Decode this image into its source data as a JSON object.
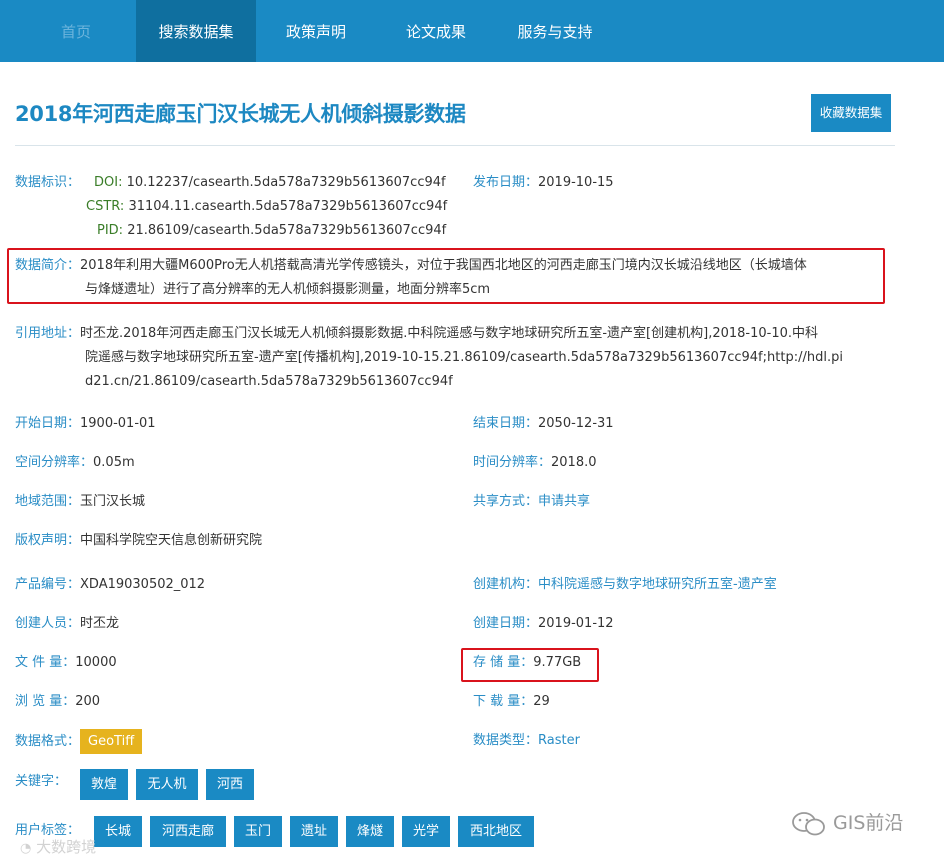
{
  "nav": {
    "home": "首页",
    "search": "搜索数据集",
    "policy": "政策声明",
    "papers": "论文成果",
    "service": "服务与支持"
  },
  "title": "2018年河西走廊玉门汉长城无人机倾斜摄影数据",
  "favorite_button": "收藏数据集",
  "identifiers": {
    "label": "数据标识：",
    "doi_key": "DOI:",
    "doi": "10.12237/casearth.5da578a7329b5613607cc94f",
    "cstr_key": "CSTR:",
    "cstr": "31104.11.casearth.5da578a7329b5613607cc94f",
    "pid_key": "PID:",
    "pid": "21.86109/casearth.5da578a7329b5613607cc94f"
  },
  "publish_date": {
    "label": "发布日期：",
    "value": "2019-10-15"
  },
  "summary": {
    "label": "数据简介：",
    "line1": "2018年利用大疆M600Pro无人机搭载高清光学传感镜头，对位于我国西北地区的河西走廊玉门境内汉长城沿线地区（长城墙体",
    "line2": "与烽燧遗址）进行了高分辨率的无人机倾斜摄影测量，地面分辨率5cm"
  },
  "citation": {
    "label": "引用地址：",
    "line1": "时丕龙.2018年河西走廊玉门汉长城无人机倾斜摄影数据.中科院遥感与数字地球研究所五室-遗产室[创建机构],2018-10-10.中科",
    "line2": "院遥感与数字地球研究所五室-遗产室[传播机构],2019-10-15.21.86109/casearth.5da578a7329b5613607cc94f;http://hdl.pi",
    "line3": "d21.cn/21.86109/casearth.5da578a7329b5613607cc94f"
  },
  "fields": {
    "start_date": {
      "label": "开始日期：",
      "value": "1900-01-01"
    },
    "end_date": {
      "label": "结束日期：",
      "value": "2050-12-31"
    },
    "spatial_res": {
      "label": "空间分辨率：",
      "value": "0.05m"
    },
    "temporal_res": {
      "label": "时间分辨率：",
      "value": "2018.0"
    },
    "region": {
      "label": "地域范围：",
      "value": "玉门汉长城"
    },
    "share_mode": {
      "label": "共享方式：",
      "value": "申请共享"
    },
    "copyright": {
      "label": "版权声明：",
      "value": "中国科学院空天信息创新研究院"
    },
    "product_no": {
      "label": "产品编号：",
      "value": "XDA19030502_012"
    },
    "creator_org": {
      "label": "创建机构：",
      "value": "中科院遥感与数字地球研究所五室-遗产室"
    },
    "creator": {
      "label": "创建人员：",
      "value": "时丕龙"
    },
    "create_date": {
      "label": "创建日期：",
      "value": "2019-01-12"
    },
    "file_count": {
      "label": "文 件 量：",
      "value": "10000"
    },
    "storage": {
      "label": "存 储 量：",
      "value": "9.77GB"
    },
    "views": {
      "label": "浏 览 量：",
      "value": "200"
    },
    "downloads": {
      "label": "下 载 量：",
      "value": "29"
    },
    "format": {
      "label": "数据格式：",
      "value": "GeoTiff"
    },
    "data_type": {
      "label": "数据类型：",
      "value": "Raster"
    }
  },
  "keywords": {
    "label": "关键字：",
    "items": [
      "敦煌",
      "无人机",
      "河西"
    ]
  },
  "user_tags": {
    "label": "用户标签：",
    "items": [
      "长城",
      "河西走廊",
      "玉门",
      "遗址",
      "烽燧",
      "光学",
      "西北地区"
    ]
  },
  "watermark": {
    "left": "大数跨境",
    "right": "GIS前沿"
  },
  "colors": {
    "primary": "#1a8ac4",
    "nav_active": "#0f6f9f",
    "label": "#2a8dc6",
    "highlight_box": "#d9131c",
    "format_tag": "#e6b31e"
  }
}
